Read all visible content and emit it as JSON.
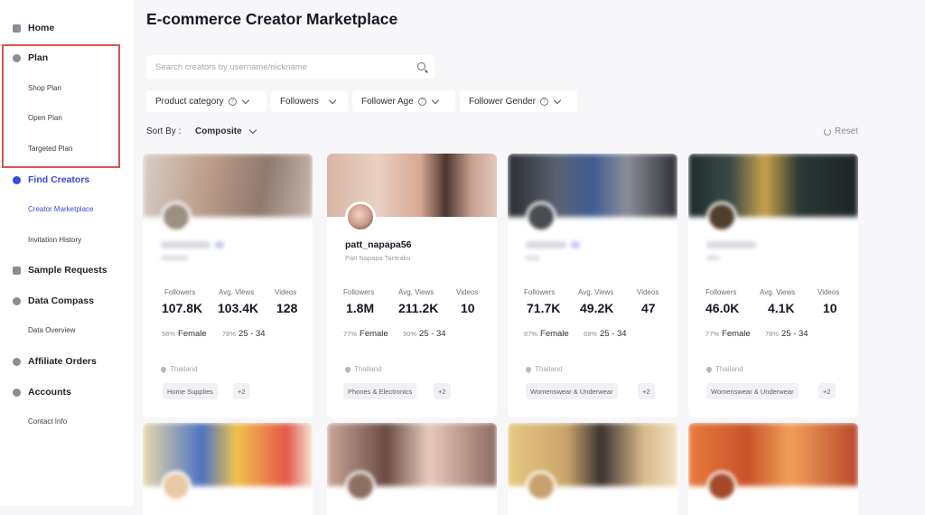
{
  "sidebar": {
    "home": "Home",
    "plan": "Plan",
    "shop_plan": "Shop Plan",
    "open_plan": "Open Plan",
    "targeted_plan": "Targeted Plan",
    "find_creators": "Find Creators",
    "creator_marketplace": "Creator Marketplace",
    "invitation_history": "Invitation History",
    "sample_requests": "Sample Requests",
    "data_compass": "Data Compass",
    "data_overview": "Data Overview",
    "affiliate_orders": "Affiliate Orders",
    "accounts": "Accounts",
    "contact_info": "Contact Info"
  },
  "header": {
    "title": "E-commerce Creator Marketplace"
  },
  "search": {
    "placeholder": "Search creators by username/nickname",
    "icon": "search-icon"
  },
  "filters": {
    "product_category": "Product category",
    "followers": "Followers",
    "follower_age": "Follower Age",
    "follower_gender": "Follower Gender"
  },
  "sort": {
    "label": "Sort By :",
    "value": "Composite",
    "reset": "Reset"
  },
  "stat_labels": {
    "followers": "Followers",
    "avg_views": "Avg. Views",
    "videos": "Videos"
  },
  "colors": {
    "accent": "#3a4ad8",
    "highlight_box": "#d9544d"
  },
  "cards": [
    {
      "username": "",
      "nickname": "",
      "followers": "107.8K",
      "avg_views": "103.4K",
      "videos": "128",
      "female_pct": "58%",
      "female": "Female",
      "age_pct": "78%",
      "age": "25 - 34",
      "location": "Thailand",
      "tag": "Home Supplies",
      "more": "+2"
    },
    {
      "username": "patt_napapa56",
      "nickname": "Patt Napapa Tantraku",
      "followers": "1.8M",
      "avg_views": "211.2K",
      "videos": "10",
      "female_pct": "77%",
      "female": "Female",
      "age_pct": "90%",
      "age": "25 - 34",
      "location": "Thailand",
      "tag": "Phones & Electronics",
      "more": "+2"
    },
    {
      "username": "",
      "nickname": "",
      "followers": "71.7K",
      "avg_views": "49.2K",
      "videos": "47",
      "female_pct": "87%",
      "female": "Female",
      "age_pct": "69%",
      "age": "25 - 34",
      "location": "Thailand",
      "tag": "Womenswear & Underwear",
      "more": "+2"
    },
    {
      "username": "",
      "nickname": "",
      "followers": "46.0K",
      "avg_views": "4.1K",
      "videos": "10",
      "female_pct": "77%",
      "female": "Female",
      "age_pct": "78%",
      "age": "25 - 34",
      "location": "Thailand",
      "tag": "Womenswear & Underwear",
      "more": "+2"
    }
  ]
}
